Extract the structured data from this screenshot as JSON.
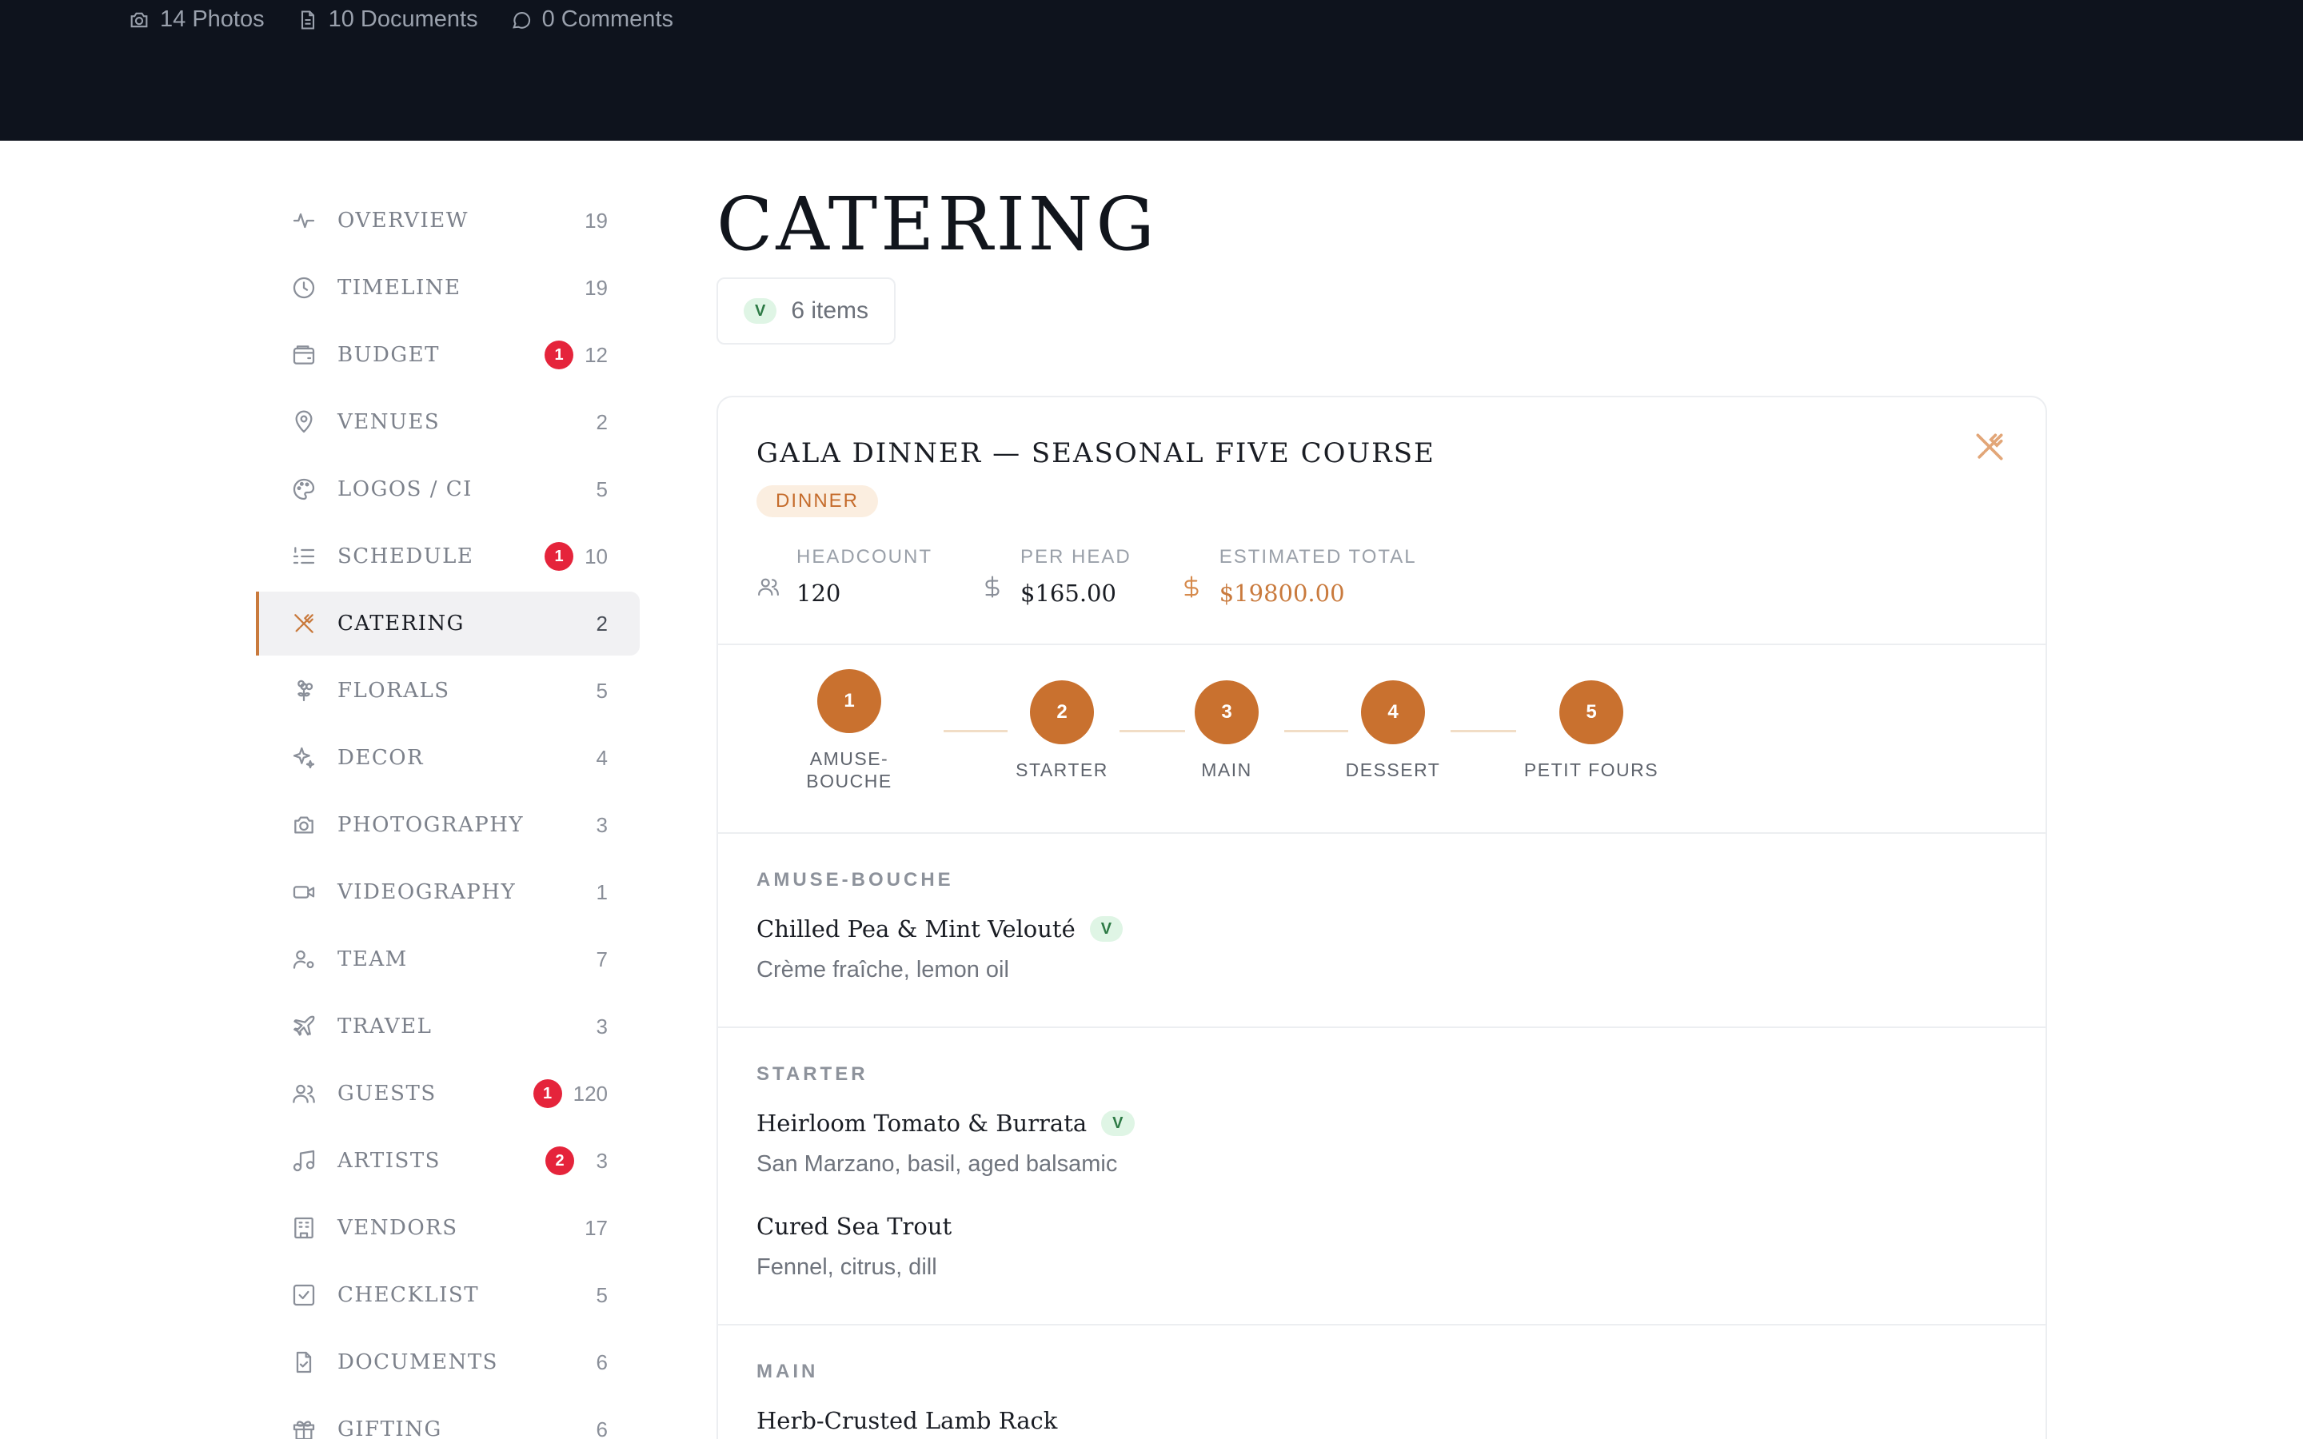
{
  "header": {
    "photos": "14 Photos",
    "documents": "10 Documents",
    "comments": "0 Comments"
  },
  "sidebar": {
    "items": [
      {
        "label": "OVERVIEW",
        "count": "19",
        "badge": null,
        "icon": "activity-icon"
      },
      {
        "label": "TIMELINE",
        "count": "19",
        "badge": null,
        "icon": "clock-icon"
      },
      {
        "label": "BUDGET",
        "count": "12",
        "badge": "1",
        "icon": "wallet-icon"
      },
      {
        "label": "VENUES",
        "count": "2",
        "badge": null,
        "icon": "map-pin-icon"
      },
      {
        "label": "LOGOS / CI",
        "count": "5",
        "badge": null,
        "icon": "palette-icon"
      },
      {
        "label": "SCHEDULE",
        "count": "10",
        "badge": "1",
        "icon": "list-ordered-icon"
      },
      {
        "label": "CATERING",
        "count": "2",
        "badge": null,
        "icon": "utensils-crossed-icon",
        "active": true
      },
      {
        "label": "FLORALS",
        "count": "5",
        "badge": null,
        "icon": "flower-icon"
      },
      {
        "label": "DECOR",
        "count": "4",
        "badge": null,
        "icon": "sparkles-icon"
      },
      {
        "label": "PHOTOGRAPHY",
        "count": "3",
        "badge": null,
        "icon": "camera-icon"
      },
      {
        "label": "VIDEOGRAPHY",
        "count": "1",
        "badge": null,
        "icon": "video-icon"
      },
      {
        "label": "TEAM",
        "count": "7",
        "badge": null,
        "icon": "user-cog-icon"
      },
      {
        "label": "TRAVEL",
        "count": "3",
        "badge": null,
        "icon": "plane-icon"
      },
      {
        "label": "GUESTS",
        "count": "120",
        "badge": "1",
        "icon": "users-icon"
      },
      {
        "label": "ARTISTS",
        "count": "3",
        "badge": "2",
        "icon": "music-icon"
      },
      {
        "label": "VENDORS",
        "count": "17",
        "badge": null,
        "icon": "building-icon"
      },
      {
        "label": "CHECKLIST",
        "count": "5",
        "badge": null,
        "icon": "check-square-icon"
      },
      {
        "label": "DOCUMENTS",
        "count": "6",
        "badge": null,
        "icon": "file-check-icon"
      },
      {
        "label": "GIFTING",
        "count": "6",
        "badge": null,
        "icon": "gift-icon"
      }
    ]
  },
  "main": {
    "title": "CATERING",
    "filter_tag": "V",
    "items_count": "6 items",
    "card": {
      "title": "GALA DINNER — SEASONAL FIVE COURSE",
      "tag": "DINNER",
      "stats": {
        "headcount_label": "HEADCOUNT",
        "headcount_value": "120",
        "per_head_label": "PER HEAD",
        "per_head_value": "$165.00",
        "total_label": "ESTIMATED TOTAL",
        "total_value": "$19800.00"
      },
      "steps": [
        {
          "num": "1",
          "label": "AMUSE-\nBOUCHE"
        },
        {
          "num": "2",
          "label": "STARTER"
        },
        {
          "num": "3",
          "label": "MAIN"
        },
        {
          "num": "4",
          "label": "DESSERT"
        },
        {
          "num": "5",
          "label": "PETIT FOURS"
        }
      ],
      "sections": [
        {
          "title": "AMUSE-BOUCHE",
          "dishes": [
            {
              "name": "Chilled Pea & Mint Velouté",
              "tag": "V",
              "desc": "Crème fraîche, lemon oil"
            }
          ]
        },
        {
          "title": "STARTER",
          "dishes": [
            {
              "name": "Heirloom Tomato & Burrata",
              "tag": "V",
              "desc": "San Marzano, basil, aged balsamic"
            },
            {
              "name": "Cured Sea Trout",
              "tag": null,
              "desc": "Fennel, citrus, dill"
            }
          ]
        },
        {
          "title": "MAIN",
          "dishes": [
            {
              "name": "Herb-Crusted Lamb Rack",
              "tag": null,
              "desc": ""
            }
          ]
        }
      ]
    }
  },
  "colors": {
    "accent": "#c9712f",
    "header_bg": "#0e131d",
    "badge_red": "#e5243b",
    "veg_green_bg": "#dff5e5"
  }
}
